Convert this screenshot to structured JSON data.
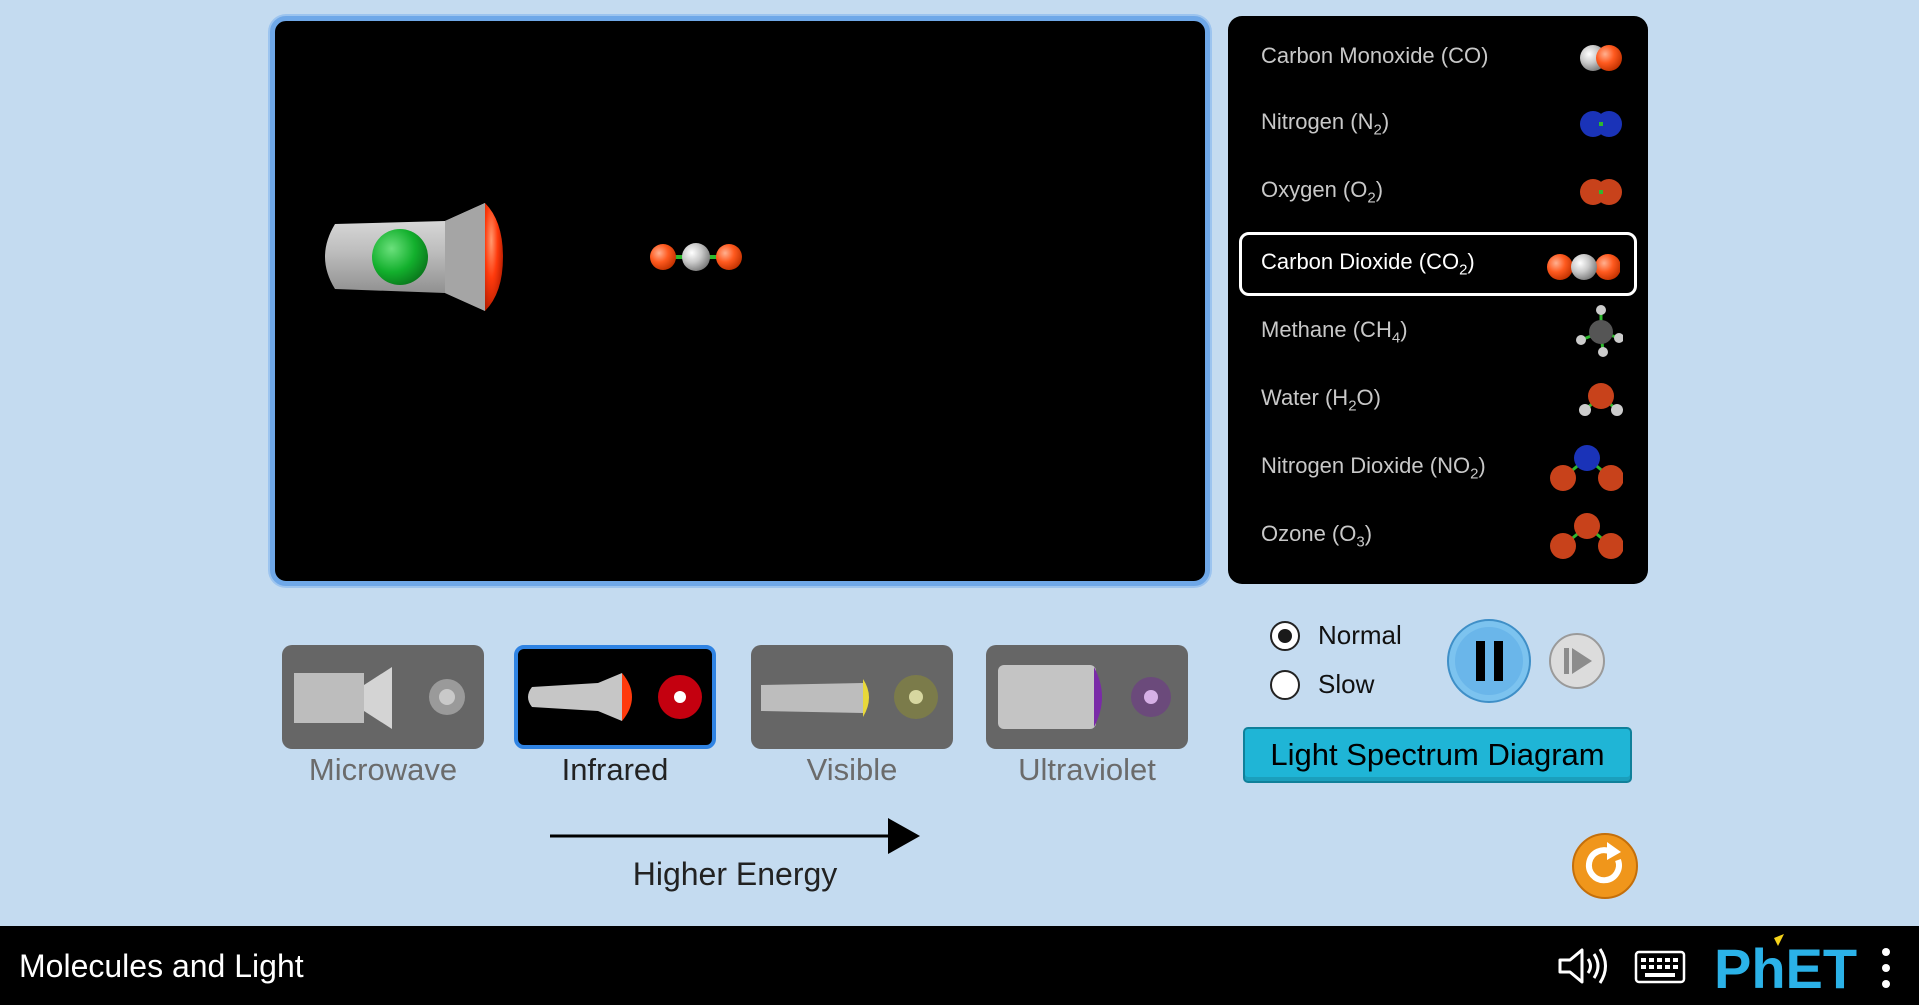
{
  "molecules": [
    {
      "label_main": "Carbon Monoxide (CO)",
      "label_sub": "",
      "label_tail": "",
      "selected": false,
      "icon": "co-molecule-icon"
    },
    {
      "label_main": "Nitrogen (N",
      "label_sub": "2",
      "label_tail": ")",
      "selected": false,
      "icon": "n2-molecule-icon"
    },
    {
      "label_main": "Oxygen (O",
      "label_sub": "2",
      "label_tail": ")",
      "selected": false,
      "icon": "o2-molecule-icon"
    },
    {
      "label_main": "Carbon Dioxide (CO",
      "label_sub": "2",
      "label_tail": ")",
      "selected": true,
      "icon": "co2-molecule-icon"
    },
    {
      "label_main": "Methane (CH",
      "label_sub": "4",
      "label_tail": ")",
      "selected": false,
      "icon": "ch4-molecule-icon"
    },
    {
      "label_main": "Water (H",
      "label_sub": "2",
      "label_tail": "O)",
      "selected": false,
      "icon": "h2o-molecule-icon"
    },
    {
      "label_main": "Nitrogen Dioxide (NO",
      "label_sub": "2",
      "label_tail": ")",
      "selected": false,
      "icon": "no2-molecule-icon"
    },
    {
      "label_main": "Ozone (O",
      "label_sub": "3",
      "label_tail": ")",
      "selected": false,
      "icon": "o3-molecule-icon"
    }
  ],
  "light_sources": [
    {
      "label": "Microwave",
      "selected": false
    },
    {
      "label": "Infrared",
      "selected": true
    },
    {
      "label": "Visible",
      "selected": false
    },
    {
      "label": "Ultraviolet",
      "selected": false
    }
  ],
  "energy_label": "Higher Energy",
  "speed": {
    "normal_label": "Normal",
    "slow_label": "Slow",
    "selected": "normal"
  },
  "spectrum_button_label": "Light Spectrum Diagram",
  "navbar": {
    "title": "Molecules and Light",
    "logo_text": "PhET"
  },
  "colors": {
    "background": "#c4dbf0",
    "play_area_border": "#6fa8e8",
    "selected_source_border": "#2f83e3",
    "spectrum_button": "#1fb5d6",
    "reset_button": "#f0961b",
    "pause_button": "#7cc3ef",
    "oxygen_atom": "#ff5a1f",
    "carbon_atom": "#bfbfbf",
    "nitrogen_atom": "#1a33b8",
    "emitter_button": "#1ec23b"
  }
}
